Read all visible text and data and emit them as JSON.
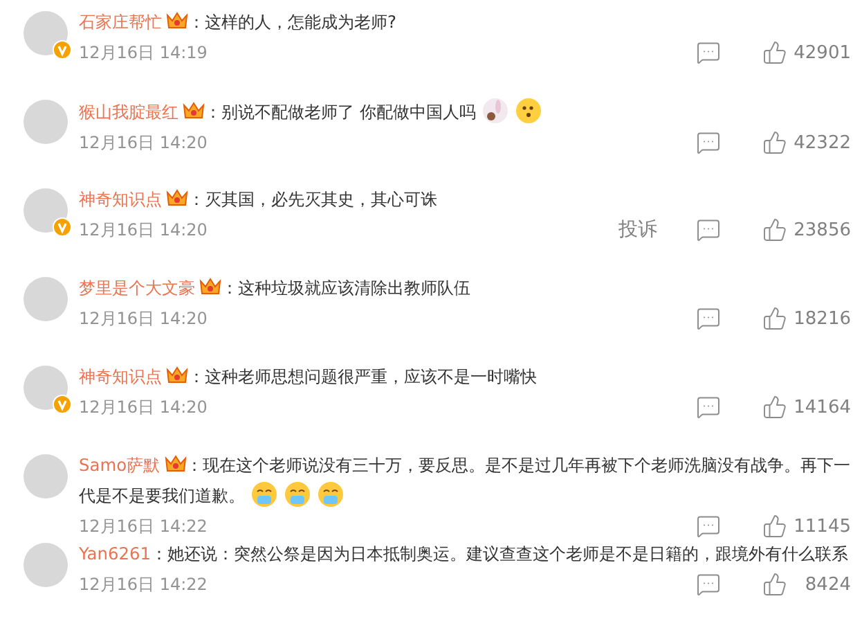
{
  "comments": [
    {
      "name": "石家庄帮忙",
      "vip": true,
      "verified": true,
      "text": "：这样的人，怎能成为老师?",
      "time": "12月16日 14:19",
      "likes": "42901"
    },
    {
      "name": "猴山我腚最红",
      "vip": true,
      "verified": false,
      "text": "：别说不配做老师了 你配做中国人吗",
      "emojis": [
        {
          "kind": "bunny"
        },
        {
          "kind": "question"
        }
      ],
      "time": "12月16日 14:20",
      "likes": "42322"
    },
    {
      "name": "神奇知识点",
      "vip": true,
      "verified": true,
      "text": "：灭其国，必先灭其史，其心可诛",
      "time": "12月16日 14:20",
      "report": "投诉",
      "likes": "23856"
    },
    {
      "name": "梦里是个大文豪",
      "vip": true,
      "verified": false,
      "text": "：这种垃圾就应该清除出教师队伍",
      "time": "12月16日 14:20",
      "likes": "18216"
    },
    {
      "name": "神奇知识点",
      "vip": true,
      "verified": true,
      "text": "：这种老师思想问题很严重，应该不是一时嘴快",
      "time": "12月16日 14:20",
      "likes": "14164"
    },
    {
      "name": "Samo萨默",
      "vip": true,
      "verified": false,
      "text": "：现在这个老师说没有三十万，要反思。是不是过几年再被下个老师洗脑没有战争。再下一代是不是要我们道歉。",
      "emojis": [
        {
          "kind": "tears"
        },
        {
          "kind": "tears"
        },
        {
          "kind": "tears"
        }
      ],
      "time": "12月16日 14:22",
      "likes": "11145"
    },
    {
      "name": "Yan6261",
      "vip": false,
      "verified": false,
      "text": "：她还说：突然公祭是因为日本抵制奥运。建议查查这个老师是不是日籍的，跟境外有什么联系",
      "time": "12月16日 14:22",
      "likes": "8424"
    }
  ]
}
